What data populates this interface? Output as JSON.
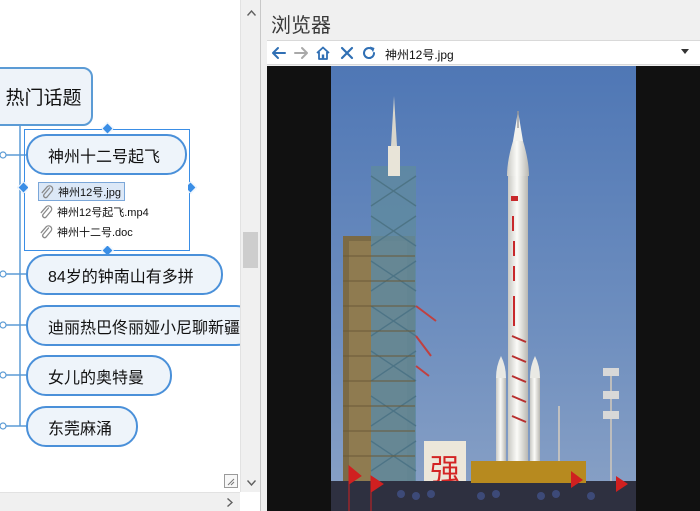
{
  "mindmap": {
    "root_label": "热门话题",
    "topics": [
      {
        "label": "神州十二号起飞"
      },
      {
        "label": "84岁的钟南山有多拼"
      },
      {
        "label": "迪丽热巴佟丽娅小尼聊新疆"
      },
      {
        "label": "女儿的奥特曼"
      },
      {
        "label": "东莞麻涌"
      }
    ],
    "attachments": [
      {
        "label": "神州12号.jpg"
      },
      {
        "label": "神州12号起飞.mp4"
      },
      {
        "label": "神州十二号.doc"
      }
    ]
  },
  "browser": {
    "title": "浏览器",
    "url": "神州12号.jpg",
    "photo_sign": "强"
  },
  "colors": {
    "accent": "#4a90d9",
    "node_fill": "#eef4fa",
    "sky": "#6f8fbf"
  },
  "icons": [
    "back-arrow-icon",
    "forward-arrow-icon",
    "home-icon",
    "stop-icon",
    "refresh-icon",
    "paperclip-icon",
    "chevron-down-icon"
  ]
}
